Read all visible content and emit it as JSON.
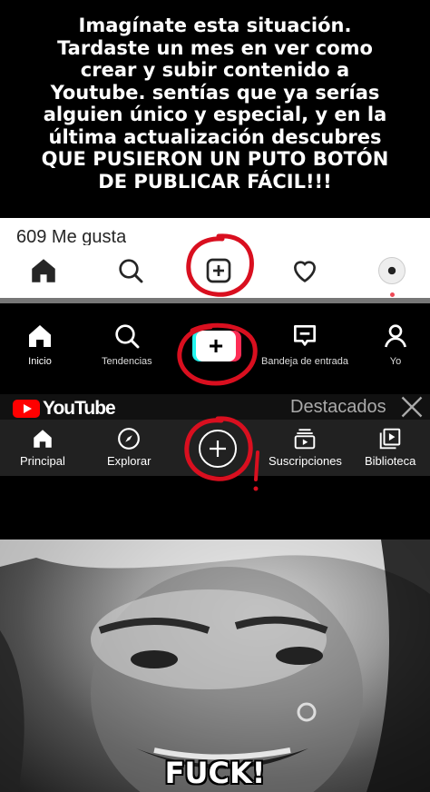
{
  "caption": {
    "lines": [
      "Imagínate esta situación.",
      "Tardaste un mes en ver como",
      "crear y subir contenido a",
      "Youtube. sentías que ya serías",
      "alguien único y especial, y en la",
      "última actualización descubres",
      "QUE PUSIERON UN PUTO BOTÓN",
      "DE PUBLICAR FÁCIL!!!"
    ]
  },
  "instagram": {
    "likes": "609 Me gusta",
    "nav": [
      {
        "name": "home-icon"
      },
      {
        "name": "search-icon"
      },
      {
        "name": "plus-square-icon"
      },
      {
        "name": "heart-icon"
      },
      {
        "name": "avatar"
      }
    ]
  },
  "tiktok": {
    "items": {
      "home": "Inicio",
      "trends": "Tendencias",
      "inbox": "Bandeja de entrada",
      "profile": "Yo"
    }
  },
  "youtube": {
    "logo_text": "YouTube",
    "featured": "Destacados",
    "items": {
      "home": "Principal",
      "explore": "Explorar",
      "subs": "Suscripciones",
      "library": "Biblioteca"
    }
  },
  "photo": {
    "caption": "FUCK!"
  },
  "colors": {
    "annotation_red": "#d90f1f",
    "tiktok_cyan": "#25f4ee",
    "tiktok_red": "#fe2c55",
    "youtube_red": "#ff0000"
  }
}
